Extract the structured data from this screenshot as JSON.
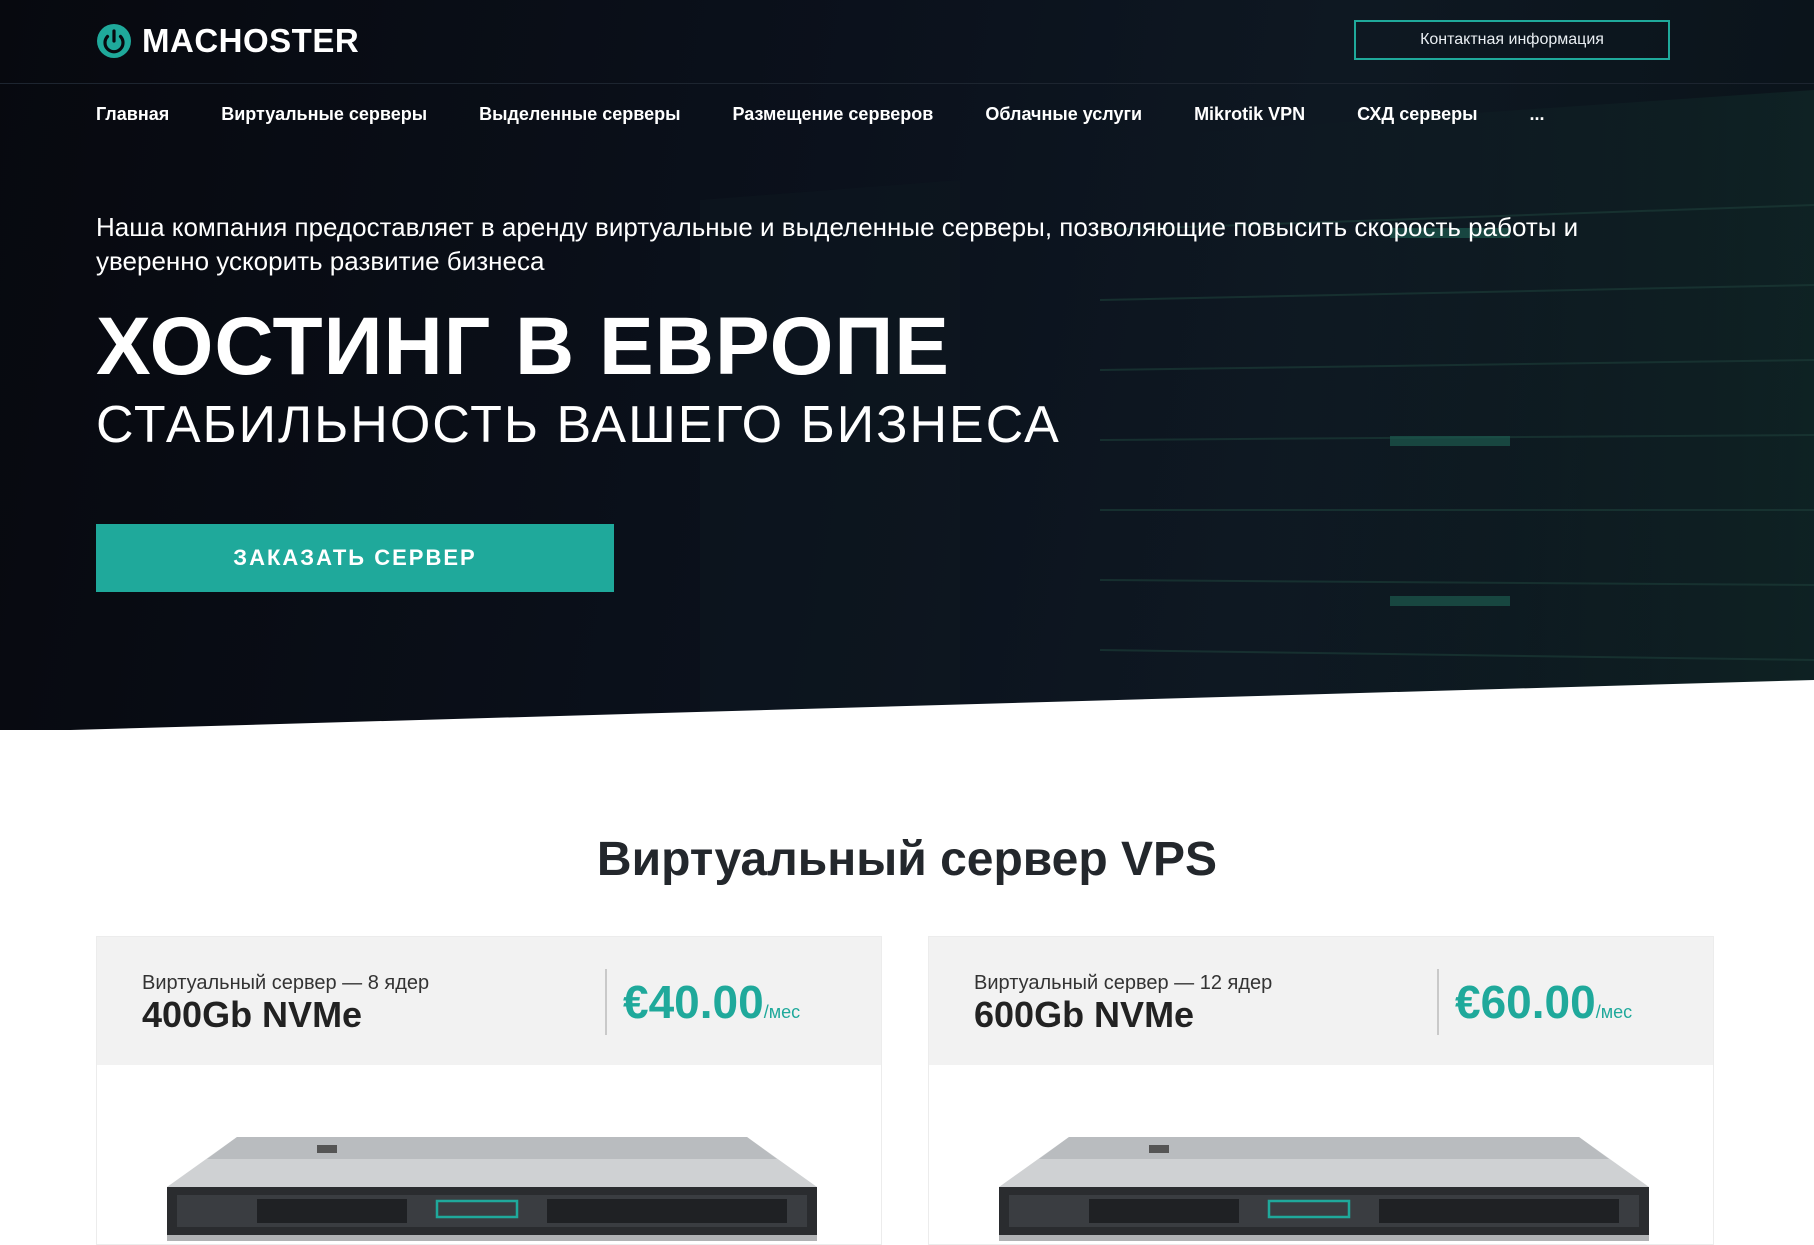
{
  "header": {
    "logo_text": "MACHOSTER",
    "contact_label": "Контактная информация"
  },
  "nav": {
    "items": [
      {
        "label": "Главная"
      },
      {
        "label": "Виртуальные серверы"
      },
      {
        "label": "Выделенные серверы"
      },
      {
        "label": "Размещение серверов"
      },
      {
        "label": "Облачные услуги"
      },
      {
        "label": "Mikrotik VPN"
      },
      {
        "label": "СХД серверы"
      },
      {
        "label": "..."
      }
    ]
  },
  "hero": {
    "lead": "Наша компания предоставляет в аренду виртуальные и выделенные серверы, позволяющие повысить скорость работы и уверенно ускорить развитие бизнеса",
    "title": "ХОСТИНГ В ЕВРОПЕ",
    "subtitle": "СТАБИЛЬНОСТЬ ВАШЕГО БИЗНЕСА",
    "cta_label": "ЗАКАЗАТЬ СЕРВЕР"
  },
  "section": {
    "title": "Виртуальный сервер VPS"
  },
  "cards": [
    {
      "subtitle": "Виртуальный сервер — 8 ядер",
      "name": "400Gb NVMe",
      "price": "€40.00",
      "unit": "/мес"
    },
    {
      "subtitle": "Виртуальный сервер — 12 ядер",
      "name": "600Gb NVMe",
      "price": "€60.00",
      "unit": "/мес"
    }
  ],
  "colors": {
    "accent": "#1fa99b",
    "hero_bg": "#0b111c",
    "text_dark": "#23272c"
  },
  "icons": {
    "logo": "power-icon"
  }
}
